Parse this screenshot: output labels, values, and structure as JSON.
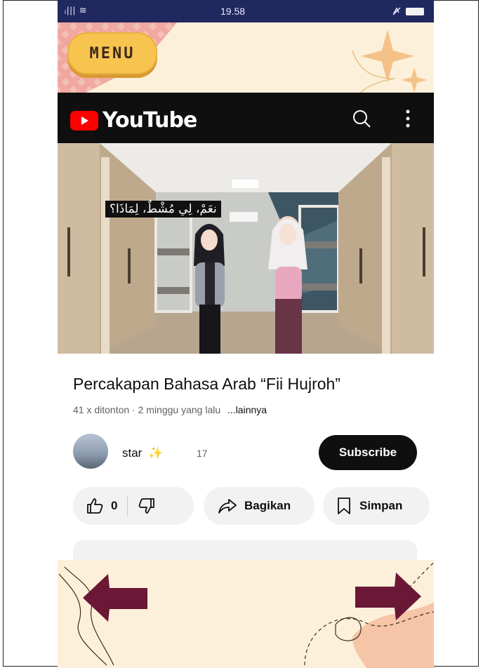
{
  "status_bar": {
    "signal": "ᵢ||| ≋",
    "time": "19.58",
    "right_icon": "muted-icon"
  },
  "banner": {
    "menu_label": "MENU"
  },
  "youtube": {
    "brand": "YouTube",
    "icons": [
      "youtube-logo-icon",
      "search-icon",
      "more-vert-icon"
    ]
  },
  "video": {
    "subtitle": "نعَمْ، لِي مُشْطٌ، لِمَاذَا؟"
  },
  "info": {
    "title": "Percakapan Bahasa Arab “Fii Hujroh”",
    "meta": "41 x ditonton · 2 minggu yang lalu",
    "more": "...lainnya"
  },
  "channel": {
    "name": "star",
    "name_emoji": "✨",
    "subscribers": "17",
    "subscribe_label": "Subscribe"
  },
  "actions": {
    "like_count": "0",
    "share_label": "Bagikan",
    "save_label": "Simpan"
  },
  "colors": {
    "youtube_red": "#ff0000",
    "arrow": "#6b1736",
    "banner_bg": "#fdf0da",
    "menu_yellow": "#f7c44f",
    "status_bar": "#20295f"
  }
}
